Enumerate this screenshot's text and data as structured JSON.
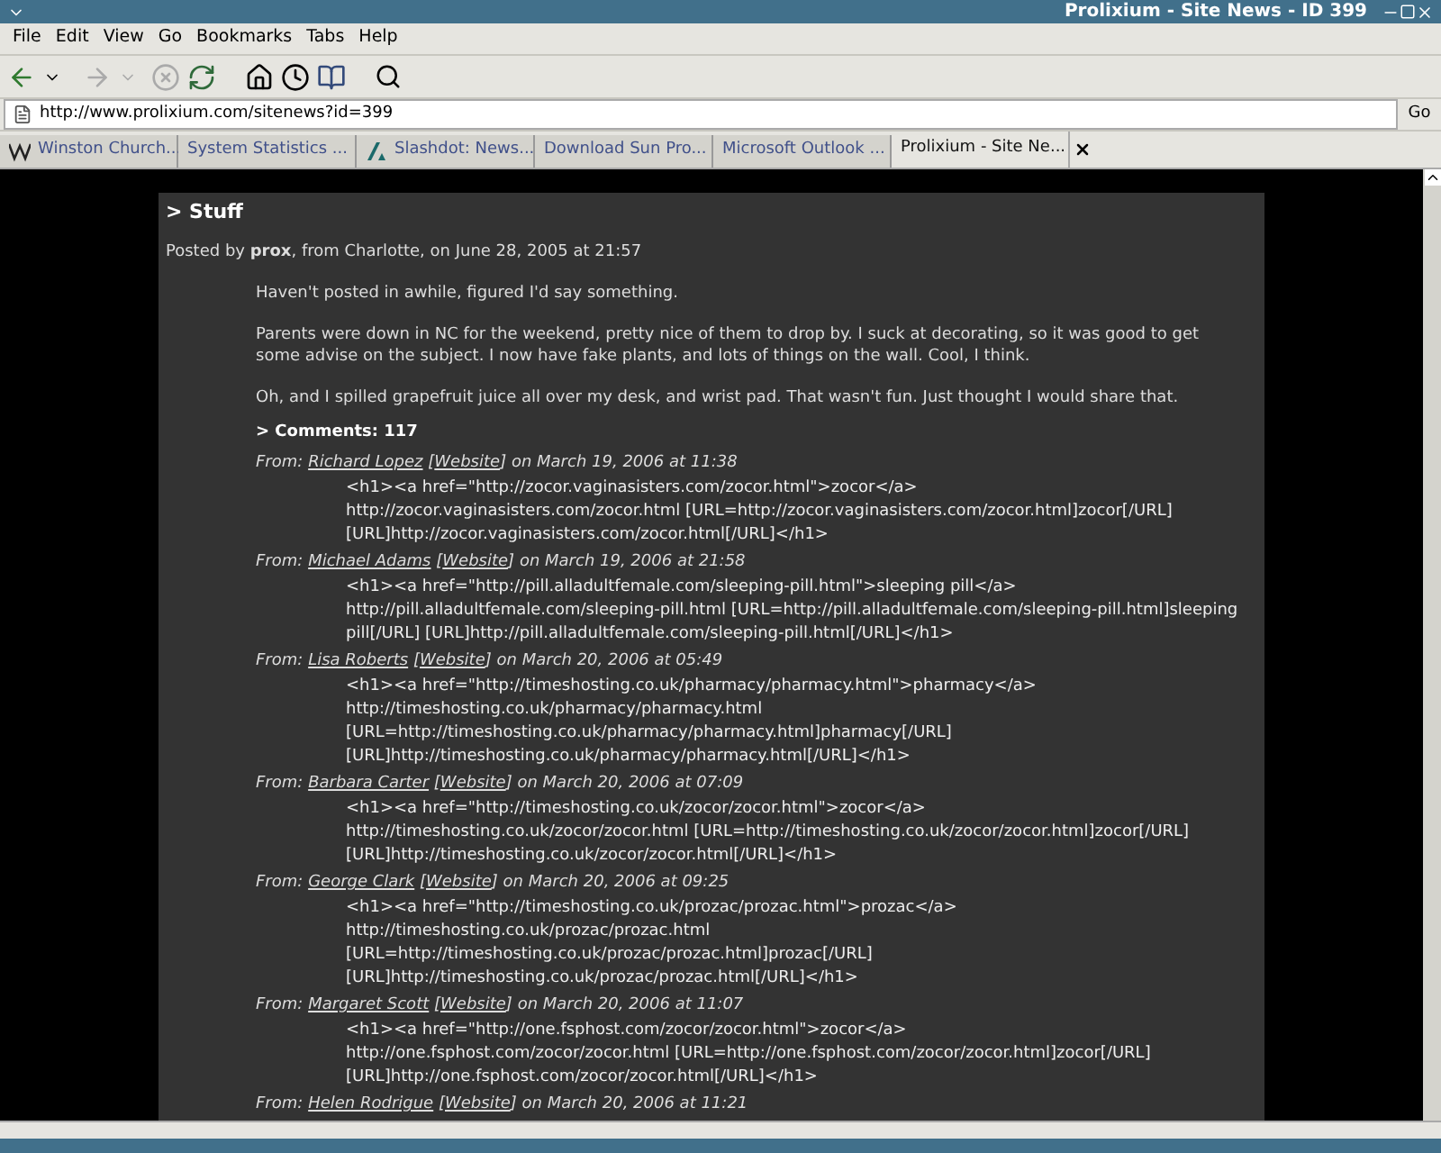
{
  "window": {
    "title": "Prolixium - Site News - ID 399"
  },
  "menu": [
    "File",
    "Edit",
    "View",
    "Go",
    "Bookmarks",
    "Tabs",
    "Help"
  ],
  "address": {
    "value": "http://www.prolixium.com/sitenews?id=399",
    "go": "Go"
  },
  "tabs": [
    {
      "label": "Winston Church...",
      "selected": false,
      "kind": "wiki"
    },
    {
      "label": "System Statistics ...",
      "selected": false,
      "kind": "plain"
    },
    {
      "label": "Slashdot: News...",
      "selected": false,
      "kind": "slash"
    },
    {
      "label": "Download Sun Pro...",
      "selected": false,
      "kind": "plain"
    },
    {
      "label": "Microsoft Outlook ...",
      "selected": false,
      "kind": "plain"
    },
    {
      "label": "Prolixium - Site Ne...",
      "selected": true,
      "kind": "plain"
    }
  ],
  "post": {
    "title": "> Stuff",
    "byline": "Posted by **prox**, from Charlotte, on June 28, 2005 at 21:57",
    "paragraphs": [
      "Haven't posted in awhile, figured I'd say something.",
      "Parents were down in NC for the weekend, pretty nice of them to drop by.  I suck at decorating, so it was good to get some advise on the subject.  I now have fake plants, and lots of things on the wall.  Cool, I think.",
      "Oh, and I spilled grapefruit juice all over my desk, and wrist pad.  That wasn't fun.  Just thought I would share that."
    ],
    "comments_heading": "> Comments: 117"
  },
  "comments": [
    {
      "from": "From:",
      "name": "Richard Lopez",
      "website": "Website",
      "date": "on March 19, 2006 at 11:38",
      "lines": [
        "<h1><a href=\"http://zocor.vaginasisters.com/zocor.html\">zocor</a>",
        "http://zocor.vaginasisters.com/zocor.html [URL=http://zocor.vaginasisters.com/zocor.html]zocor[/URL]",
        "[URL]http://zocor.vaginasisters.com/zocor.html[/URL]</h1>"
      ]
    },
    {
      "from": "From:",
      "name": "Michael Adams",
      "website": "Website",
      "date": "on March 19, 2006 at 21:58",
      "lines": [
        "<h1><a href=\"http://pill.alladultfemale.com/sleeping-pill.html\">sleeping pill</a>",
        "http://pill.alladultfemale.com/sleeping-pill.html [URL=http://pill.alladultfemale.com/sleeping-pill.html]sleeping",
        "pill[/URL] [URL]http://pill.alladultfemale.com/sleeping-pill.html[/URL]</h1>"
      ]
    },
    {
      "from": "From:",
      "name": "Lisa Roberts",
      "website": "Website",
      "date": "on March 20, 2006 at 05:49",
      "lines": [
        "<h1><a href=\"http://timeshosting.co.uk/pharmacy/pharmacy.html\">pharmacy</a>",
        "http://timeshosting.co.uk/pharmacy/pharmacy.html",
        "[URL=http://timeshosting.co.uk/pharmacy/pharmacy.html]pharmacy[/URL]",
        "[URL]http://timeshosting.co.uk/pharmacy/pharmacy.html[/URL]</h1>"
      ]
    },
    {
      "from": "From:",
      "name": "Barbara Carter",
      "website": "Website",
      "date": "on March 20, 2006 at 07:09",
      "lines": [
        "<h1><a href=\"http://timeshosting.co.uk/zocor/zocor.html\">zocor</a>",
        "http://timeshosting.co.uk/zocor/zocor.html [URL=http://timeshosting.co.uk/zocor/zocor.html]zocor[/URL]",
        "[URL]http://timeshosting.co.uk/zocor/zocor.html[/URL]</h1>"
      ]
    },
    {
      "from": "From:",
      "name": "George Clark",
      "website": "Website",
      "date": "on March 20, 2006 at 09:25",
      "lines": [
        "<h1><a href=\"http://timeshosting.co.uk/prozac/prozac.html\">prozac</a>",
        "http://timeshosting.co.uk/prozac/prozac.html",
        "[URL=http://timeshosting.co.uk/prozac/prozac.html]prozac[/URL]",
        "[URL]http://timeshosting.co.uk/prozac/prozac.html[/URL]</h1>"
      ]
    },
    {
      "from": "From:",
      "name": "Margaret Scott",
      "website": "Website",
      "date": "on March 20, 2006 at 11:07",
      "lines": [
        "<h1><a href=\"http://one.fsphost.com/zocor/zocor.html\">zocor</a>",
        "http://one.fsphost.com/zocor/zocor.html [URL=http://one.fsphost.com/zocor/zocor.html]zocor[/URL]",
        "[URL]http://one.fsphost.com/zocor/zocor.html[/URL]</h1>"
      ]
    },
    {
      "from": "From:",
      "name": "Helen Rodrigue",
      "website": "Website",
      "date": "on March 20, 2006 at 11:21"
    }
  ],
  "brackets": {
    "open": "[",
    "close": "]"
  }
}
